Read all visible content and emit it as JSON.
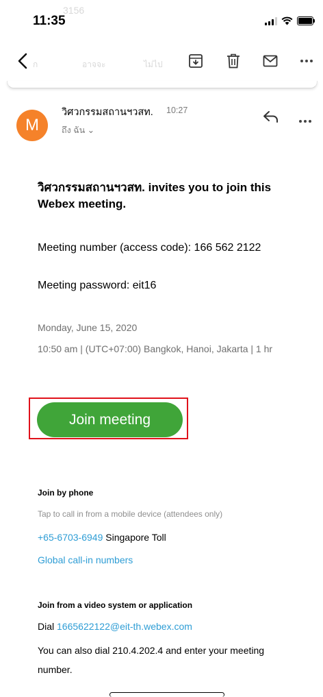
{
  "status_bar": {
    "time": "11:35"
  },
  "toolbar": {
    "faded_texts": [
      "3156",
      "ก",
      "อาจจะ",
      "ไม่ไป"
    ],
    "icons": [
      "back-icon",
      "archive-icon",
      "trash-icon",
      "mail-icon",
      "more-icon"
    ]
  },
  "email": {
    "sender_initial": "M",
    "sender_name": "วิศวกรรมสถานฯวสท.",
    "time": "10:27",
    "recipient": "ถึง ฉัน ⌄",
    "heading": "วิศวกรรมสถานฯวสท. invites you to join this Webex meeting.",
    "meeting_number": "Meeting number (access code): 166 562 2122",
    "meeting_password": "Meeting password: eit16",
    "date": "Monday, June 15, 2020",
    "time_zone": "10:50 am  |  (UTC+07:00) Bangkok, Hanoi, Jakarta  |  1 hr",
    "join_button": "Join meeting",
    "join_by_phone_title": "Join by phone",
    "tap_to_call": "Tap to call in from a mobile device (attendees only)",
    "phone_number": "+65-6703-6949",
    "phone_label": " Singapore Toll",
    "global_numbers": "Global call-in numbers",
    "video_title": "Join from a video system or application",
    "dial_prefix": "Dial ",
    "dial_address": "1665622122@eit-th.webex.com",
    "also_dial": "You can also dial 210.4.202.4 and enter your meeting number."
  },
  "colors": {
    "avatar": "#f5822a",
    "join_button": "#40a539",
    "link": "#2e9dd5",
    "highlight": "#e0111a"
  }
}
